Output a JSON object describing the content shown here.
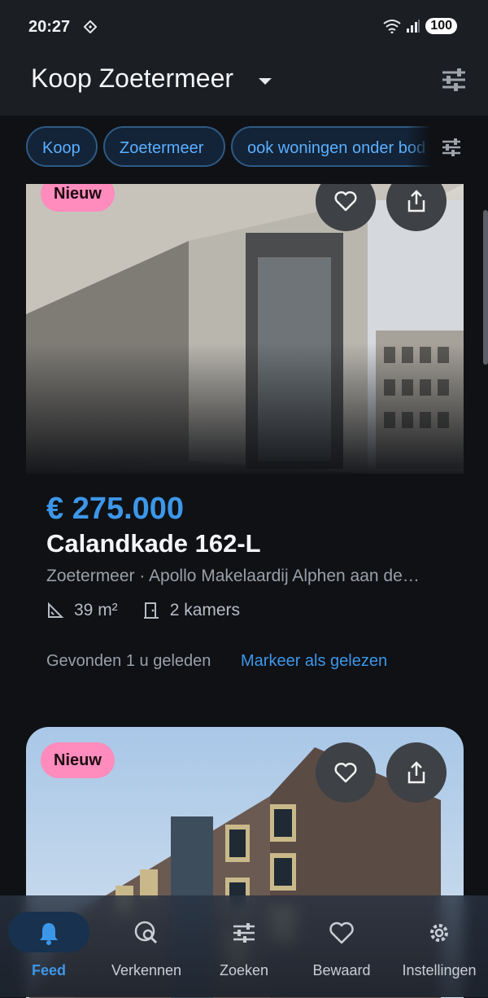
{
  "status": {
    "time": "20:27",
    "battery": "100"
  },
  "header": {
    "title": "Koop Zoetermeer"
  },
  "chips": [
    {
      "label": "Koop"
    },
    {
      "label": "Zoetermeer"
    },
    {
      "label": "ook woningen onder bod"
    }
  ],
  "listings": [
    {
      "badge": "Nieuw",
      "price": "€ 275.000",
      "address": "Calandkade 162-L",
      "subline": "Zoetermeer · Apollo Makelaardij Alphen aan de…",
      "area": "39 m²",
      "rooms": "2 kamers",
      "found": "Gevonden 1 u geleden",
      "mark_read": "Markeer als gelezen"
    },
    {
      "badge": "Nieuw"
    }
  ],
  "nav": [
    {
      "label": "Feed",
      "icon": "bell-icon",
      "active": true
    },
    {
      "label": "Verkennen",
      "icon": "explore-search-icon"
    },
    {
      "label": "Zoeken",
      "icon": "tune-icon"
    },
    {
      "label": "Bewaard",
      "icon": "heart-icon"
    },
    {
      "label": "Instellingen",
      "icon": "gear-icon"
    }
  ],
  "colors": {
    "accent": "#3d97e8",
    "badge": "#ff8cbc",
    "background": "#0f1115",
    "appbar": "#1b1e23"
  }
}
